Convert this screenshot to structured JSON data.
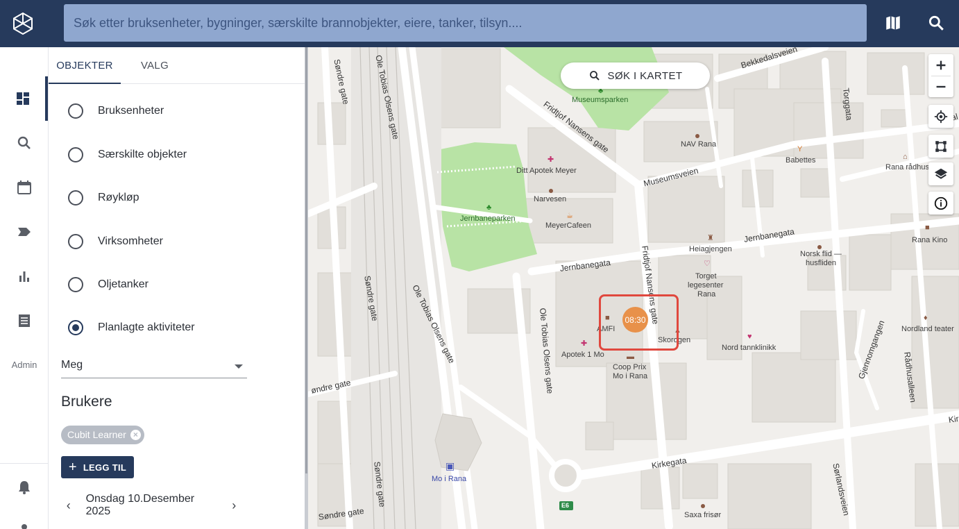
{
  "header": {
    "search_placeholder": "Søk etter bruksenheter, bygninger, særskilte brannobjekter, eiere, tanker, tilsyn...."
  },
  "rail": {
    "admin_label": "Admin"
  },
  "panel": {
    "tabs": [
      {
        "label": "OBJEKTER",
        "active": true
      },
      {
        "label": "VALG",
        "active": false
      }
    ],
    "options": [
      {
        "label": "Bruksenheter",
        "checked": false
      },
      {
        "label": "Særskilte objekter",
        "checked": false
      },
      {
        "label": "Røykløp",
        "checked": false
      },
      {
        "label": "Virksomheter",
        "checked": false
      },
      {
        "label": "Oljetanker",
        "checked": false
      },
      {
        "label": "Planlagte aktiviteter",
        "checked": true
      }
    ],
    "owner_select": "Meg",
    "users_title": "Brukere",
    "user_chip": "Cubit Learner",
    "chip_remove_symbol": "×",
    "add_button": "LEGG TIL",
    "add_symbol": "+",
    "date": "Onsdag 10.Desember 2025",
    "prev_symbol": "‹",
    "next_symbol": "›"
  },
  "map": {
    "search_button": "SØK I KARTET",
    "marker_time": "08:30",
    "places": {
      "museumsparken": "Museumsparken",
      "jernbaneparken": "Jernbaneparken",
      "ditt_apotek": "Ditt Apotek Meyer",
      "narvesen": "Narvesen",
      "meyercafeen": "MeyerCafeen",
      "nav": "NAV Rana",
      "babettes": "Babettes",
      "radhus": "Rana rådhus",
      "heiagjengen": "Heiagjengen",
      "norsk_flid_1": "Norsk flid —",
      "norsk_flid_2": "husfliden",
      "rana_kino": "Rana Kino",
      "torget_1": "Torget",
      "torget_2": "legesenter",
      "torget_3": "Rana",
      "amfi": "AMFI",
      "skorogen": "Skorogen",
      "nord_tann": "Nord tannklinikk",
      "apotek1": "Apotek 1 Mo",
      "coop_1": "Coop Prix",
      "coop_2": "Mo i Rana",
      "nordland_teater": "Nordland teater",
      "mo_i_rana": "Mo i Rana",
      "saxa": "Saxa frisør",
      "e6": "E6"
    },
    "roads": {
      "ole_tobias_1": "Ole Tobias Olsens gate",
      "ole_tobias_2": "Ole Tobias Olsens gate",
      "ole_tobias_3": "Ole Tobias Olsens gate",
      "sondre_1": "Søndre gate",
      "sondre_2": "Søndre gate",
      "sondre_3": "øndre gate",
      "sondre_4": "Søndre gate",
      "sondre_5": "Søndre gate",
      "fridtjof_1": "Fridtjof Nansens gate",
      "fridtjof_2": "Fridtjof Nansens gate",
      "museumsveien": "Museumsveien",
      "jernbanegata_1": "Jernbanegata",
      "jernbanegata_2": "Jernbanegata",
      "bekkedalsveien": "Bekkedalsveien",
      "torggata": "Torggata",
      "kolonial": "Kolonial",
      "kirkegata": "Kirkegata",
      "gjennomgangen": "Gjennomgangen",
      "radhusalleen": "Rådhusalleen",
      "sorlandsveien": "Sørlandsveien",
      "kir": "Kir"
    }
  },
  "colors": {
    "header": "#263a5c",
    "search_field": "#8fa7cf",
    "park": "#b8e3a5",
    "marker": "#e8914a",
    "highlight": "#e0483e"
  }
}
